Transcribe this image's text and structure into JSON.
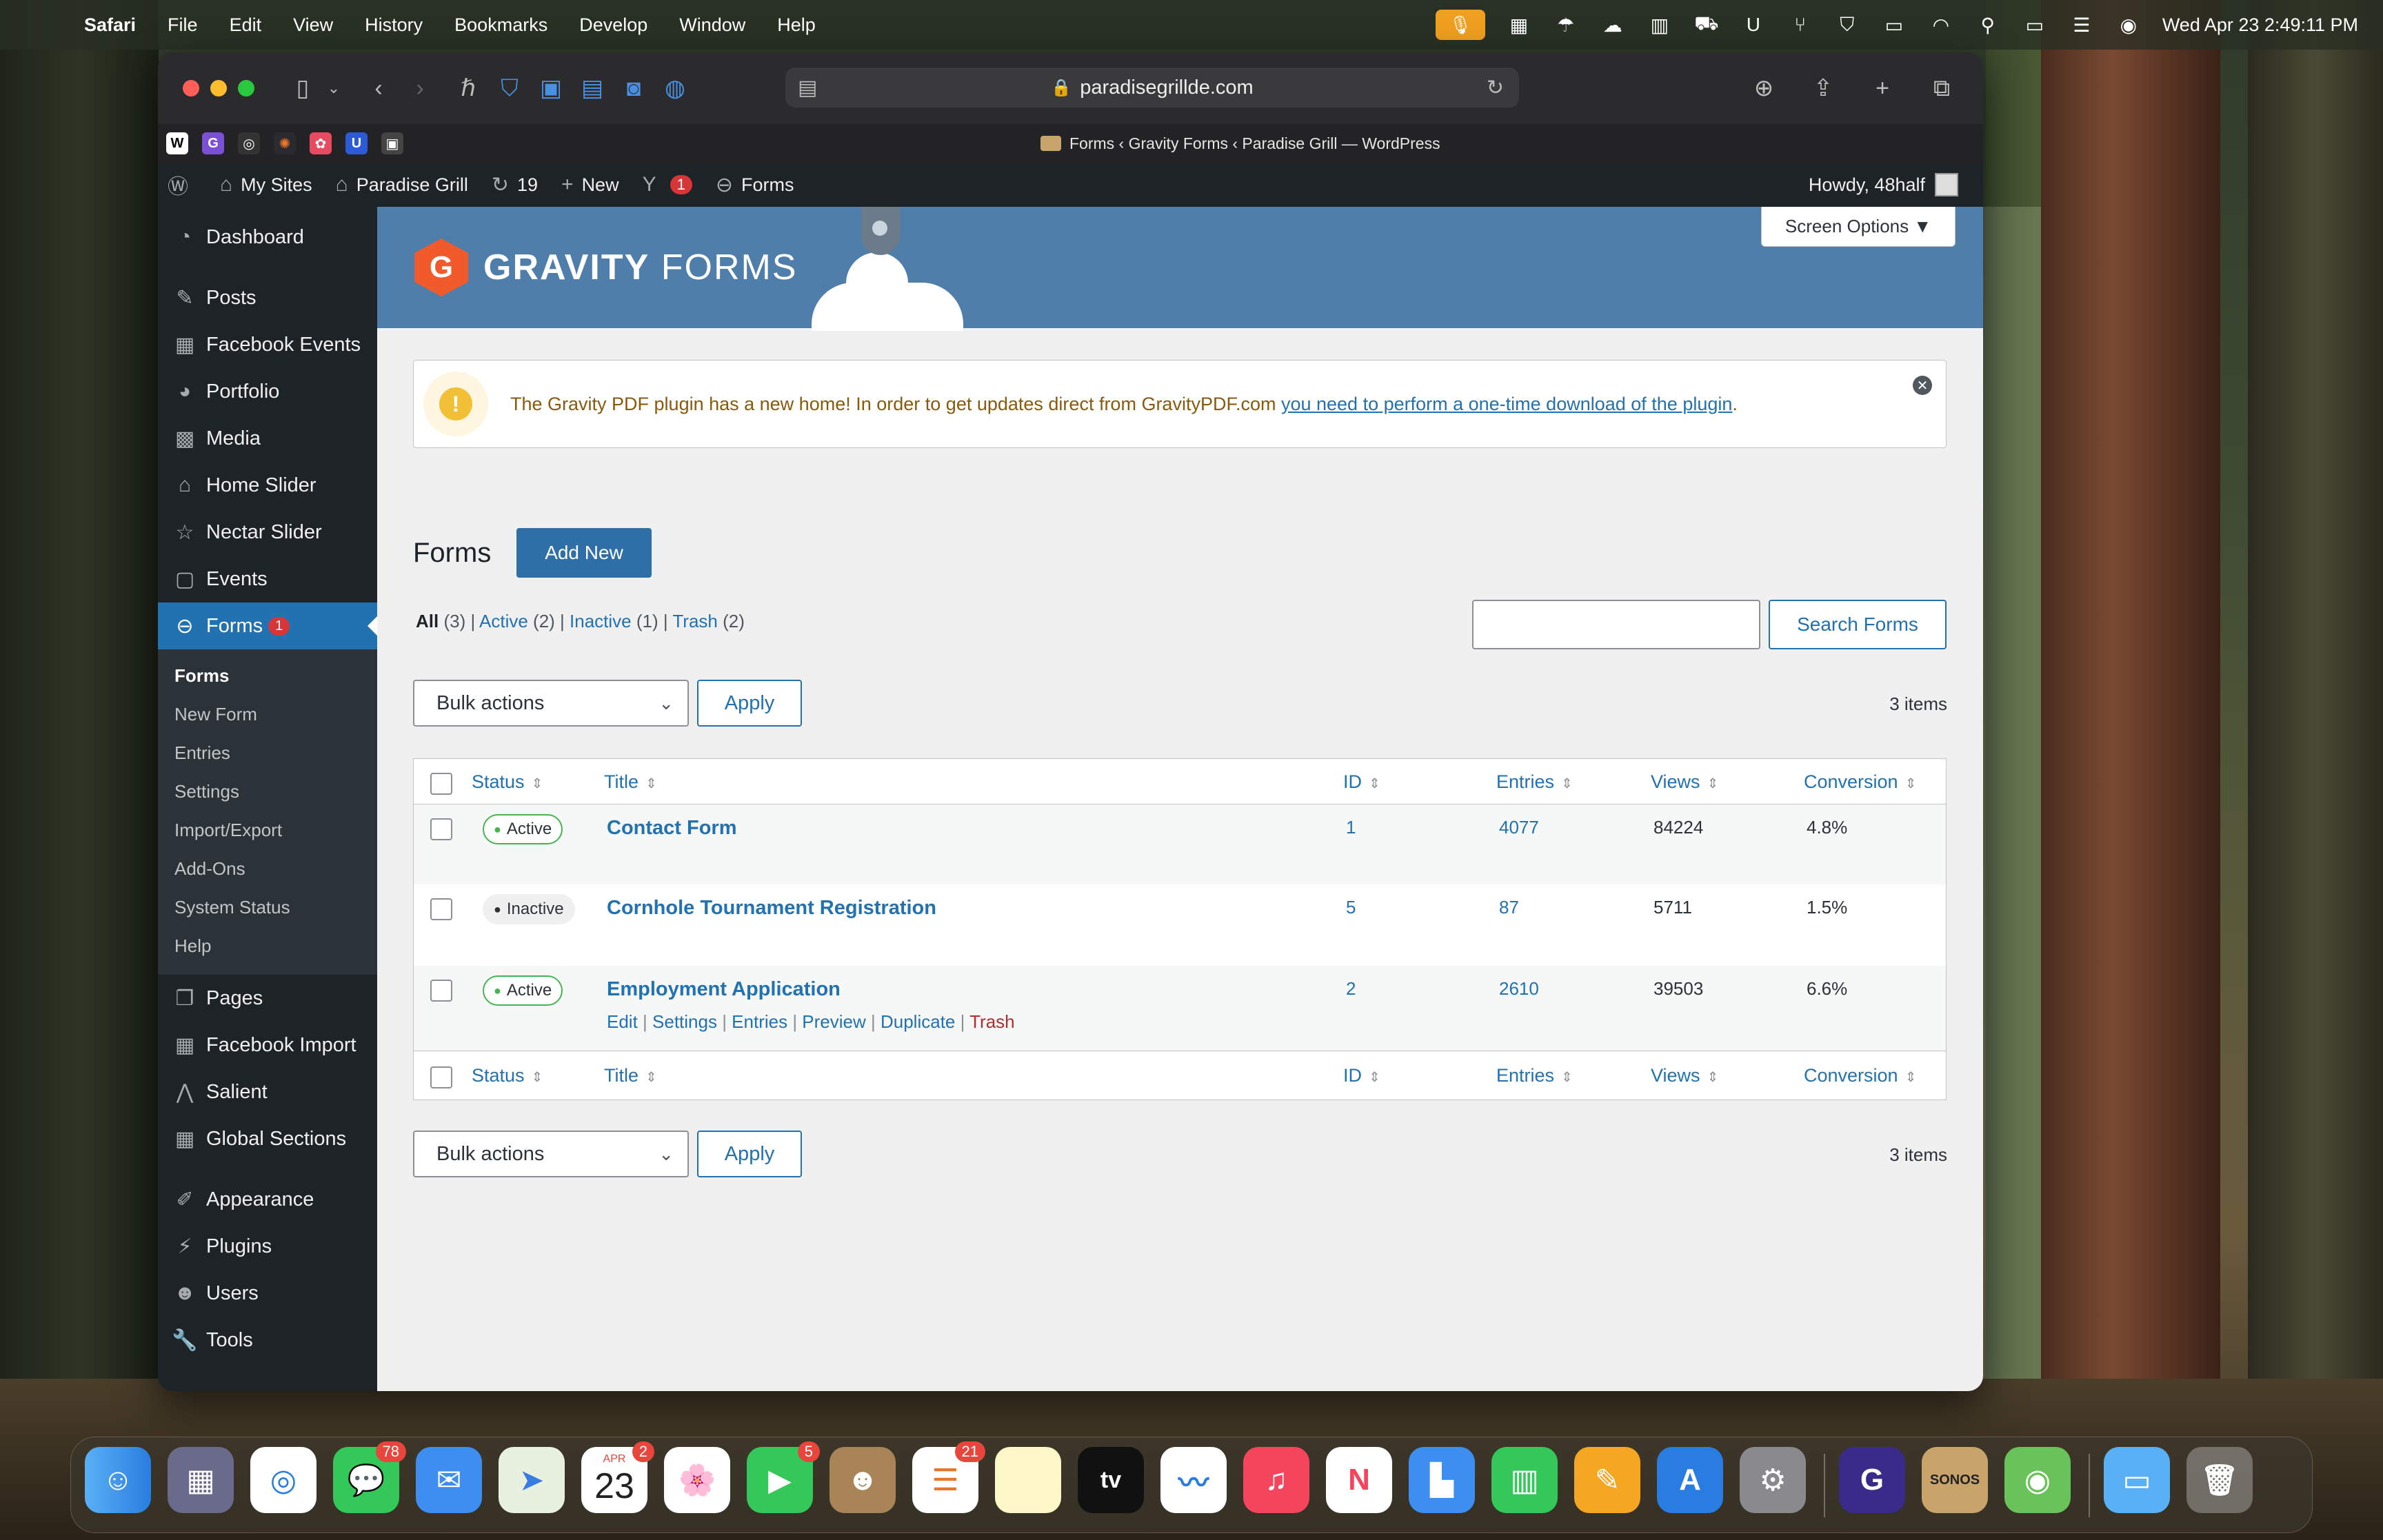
{
  "menubar": {
    "apple": "",
    "app": "Safari",
    "items": [
      "File",
      "Edit",
      "View",
      "History",
      "Bookmarks",
      "Develop",
      "Window",
      "Help"
    ],
    "clock": "Wed Apr 23  2:49:11 PM"
  },
  "browser": {
    "url": "paradisegrillde.com",
    "tab_title": "Forms ‹ Gravity Forms ‹ Paradise Grill — WordPress"
  },
  "adminbar": {
    "my_sites": "My Sites",
    "site_name": "Paradise Grill",
    "updates": "19",
    "new": "New",
    "yoast_badge": "1",
    "forms": "Forms",
    "howdy": "Howdy, 48half"
  },
  "sidebar": {
    "items": [
      {
        "label": "Dashboard",
        "icon": "dashboard-icon"
      },
      {
        "label": "Posts",
        "icon": "pin-icon"
      },
      {
        "label": "Facebook Events",
        "icon": "calendar-icon"
      },
      {
        "label": "Portfolio",
        "icon": "palette-icon"
      },
      {
        "label": "Media",
        "icon": "media-icon"
      },
      {
        "label": "Home Slider",
        "icon": "home-icon"
      },
      {
        "label": "Nectar Slider",
        "icon": "star-icon"
      },
      {
        "label": "Events",
        "icon": "calendar-icon"
      }
    ],
    "forms": {
      "label": "Forms",
      "badge": "1"
    },
    "submenu": [
      "Forms",
      "New Form",
      "Entries",
      "Settings",
      "Import/Export",
      "Add-Ons",
      "System Status",
      "Help"
    ],
    "items2": [
      {
        "label": "Pages"
      },
      {
        "label": "Facebook Import"
      },
      {
        "label": "Salient"
      },
      {
        "label": "Global Sections"
      }
    ],
    "items3": [
      {
        "label": "Appearance"
      },
      {
        "label": "Plugins"
      },
      {
        "label": "Users"
      },
      {
        "label": "Tools"
      }
    ]
  },
  "header": {
    "brand_bold": "GRAVITY",
    "brand_light": " FORMS",
    "screen_options": "Screen Options ▼"
  },
  "notice": {
    "text": "The Gravity PDF plugin has a new home! In order to get updates direct from GravityPDF.com ",
    "link": "you need to perform a one-time download of the plugin",
    "end": "."
  },
  "page": {
    "title": "Forms",
    "add_new": "Add New",
    "filters": {
      "all": "All",
      "all_count": " (3)",
      "active": "Active",
      "active_count": " (2)",
      "inactive": "Inactive",
      "inactive_count": " (1)",
      "trash": "Trash",
      "trash_count": " (2)",
      "sep": " | "
    },
    "search_button": "Search Forms",
    "search_value": "",
    "bulk_actions": "Bulk actions",
    "apply": "Apply",
    "items_count": "3 items"
  },
  "table": {
    "columns": [
      "Status",
      "Title",
      "ID",
      "Entries",
      "Views",
      "Conversion"
    ],
    "rows": [
      {
        "status": "Active",
        "title": "Contact Form",
        "id": "1",
        "entries": "4077",
        "views": "84224",
        "conversion": "4.8%"
      },
      {
        "status": "Inactive",
        "title": "Cornhole Tournament Registration",
        "id": "5",
        "entries": "87",
        "views": "5711",
        "conversion": "1.5%"
      },
      {
        "status": "Active",
        "title": "Employment Application",
        "id": "2",
        "entries": "2610",
        "views": "39503",
        "conversion": "6.6%"
      }
    ],
    "row_actions": [
      "Edit",
      "Settings",
      "Entries",
      "Preview",
      "Duplicate",
      "Trash"
    ]
  },
  "dock": {
    "badges": {
      "messages": "78",
      "calendar": "2",
      "facetime": "5",
      "reminders": "21"
    },
    "calendar_month": "APR",
    "calendar_day": "23",
    "sonos": "SONOS",
    "tv": "tv"
  }
}
